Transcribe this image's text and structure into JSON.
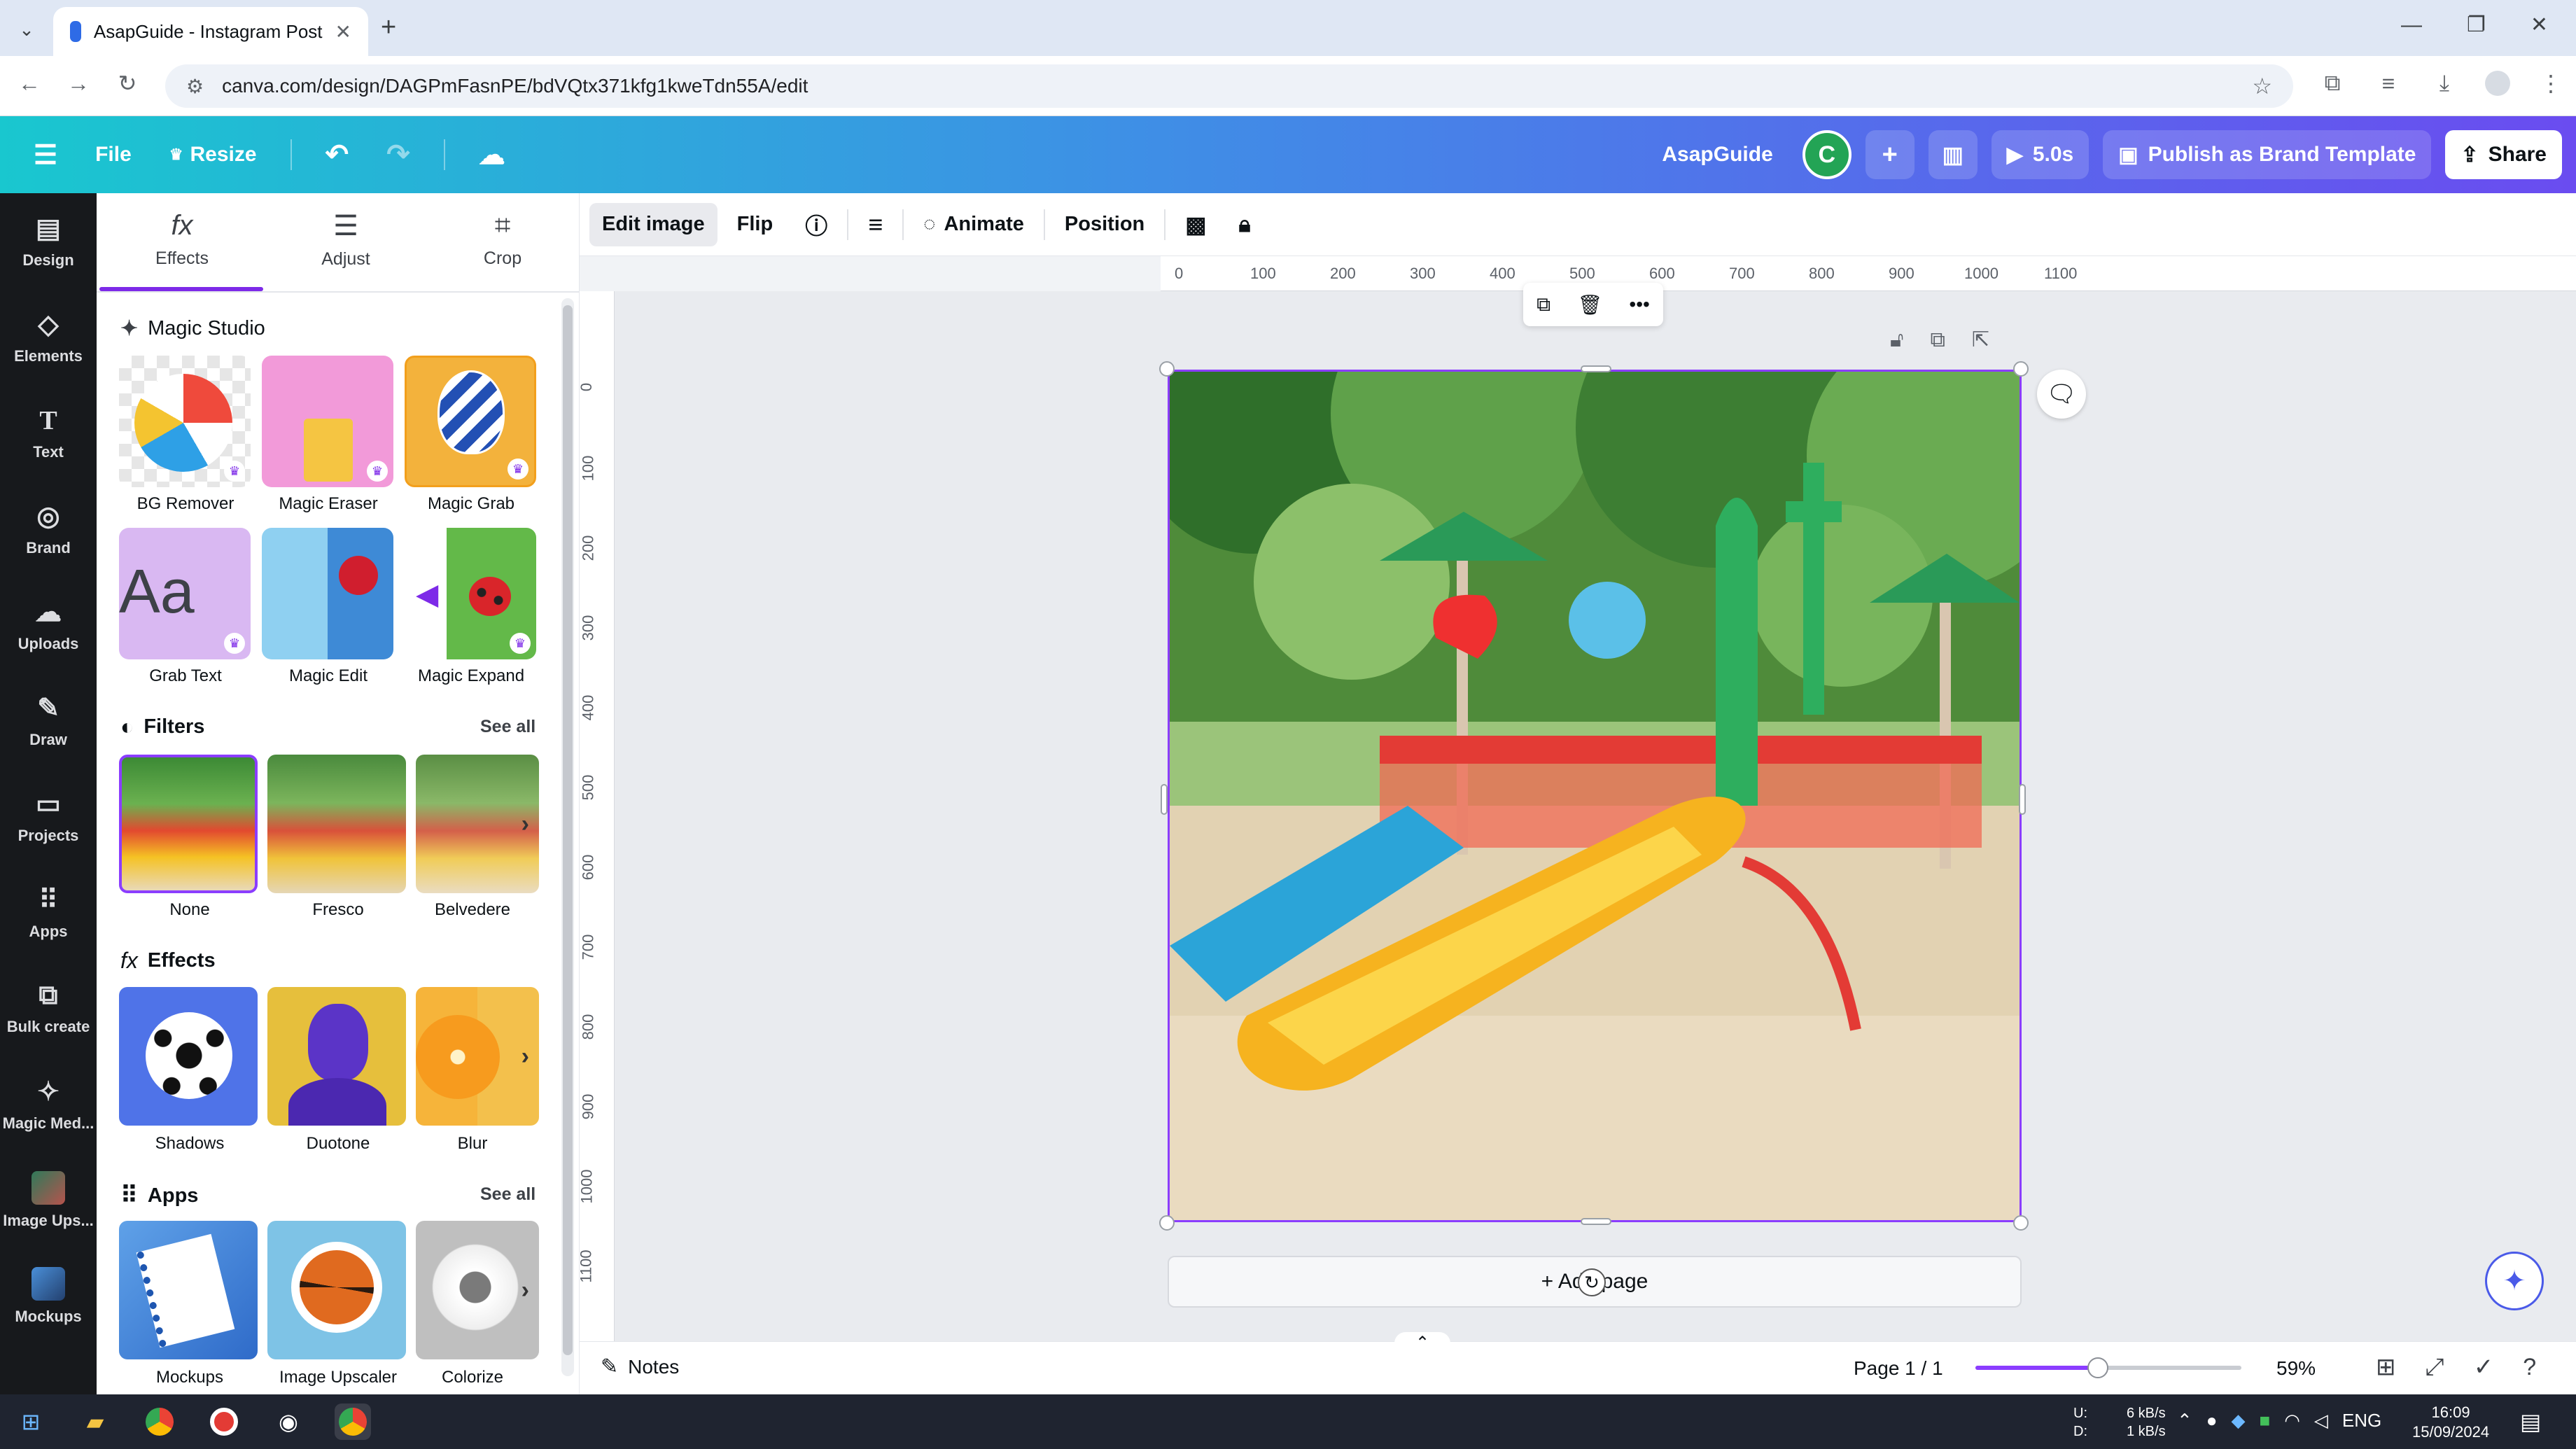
{
  "browser": {
    "tab_title": "AsapGuide - Instagram Post",
    "url": "canva.com/design/DAGPmFasnPE/bdVQtx371kfg1kweTdn55A/edit"
  },
  "header": {
    "file": "File",
    "resize": "Resize",
    "brand": "AsapGuide",
    "avatar_letter": "C",
    "play_time": "5.0s",
    "publish": "Publish as Brand Template",
    "share": "Share"
  },
  "rail": [
    {
      "label": "Design",
      "icon": "design-icon"
    },
    {
      "label": "Elements",
      "icon": "elements-icon"
    },
    {
      "label": "Text",
      "icon": "text-icon"
    },
    {
      "label": "Brand",
      "icon": "brand-icon"
    },
    {
      "label": "Uploads",
      "icon": "uploads-icon"
    },
    {
      "label": "Draw",
      "icon": "draw-icon"
    },
    {
      "label": "Projects",
      "icon": "projects-icon"
    },
    {
      "label": "Apps",
      "icon": "apps-icon"
    },
    {
      "label": "Bulk create",
      "icon": "bulk-create-icon"
    },
    {
      "label": "Magic Med...",
      "icon": "magic-media-icon"
    },
    {
      "label": "Image Ups...",
      "icon": "image-upscaler-icon"
    },
    {
      "label": "Mockups",
      "icon": "mockups-icon"
    }
  ],
  "panel": {
    "tabs": [
      {
        "label": "Effects"
      },
      {
        "label": "Adjust"
      },
      {
        "label": "Crop"
      }
    ],
    "magic_studio": {
      "title": "Magic Studio",
      "tools": [
        {
          "label": "BG Remover"
        },
        {
          "label": "Magic Eraser"
        },
        {
          "label": "Magic Grab"
        },
        {
          "label": "Grab Text"
        },
        {
          "label": "Magic Edit"
        },
        {
          "label": "Magic Expand"
        }
      ]
    },
    "filters": {
      "title": "Filters",
      "see_all": "See all",
      "items": [
        {
          "label": "None"
        },
        {
          "label": "Fresco"
        },
        {
          "label": "Belvedere"
        }
      ]
    },
    "effects": {
      "title": "Effects",
      "items": [
        {
          "label": "Shadows"
        },
        {
          "label": "Duotone"
        },
        {
          "label": "Blur"
        }
      ]
    },
    "apps": {
      "title": "Apps",
      "see_all": "See all",
      "items": [
        {
          "label": "Mockups"
        },
        {
          "label": "Image Upscaler"
        },
        {
          "label": "Colorize"
        }
      ]
    }
  },
  "toolbar": {
    "edit_image": "Edit image",
    "flip": "Flip",
    "animate": "Animate",
    "position": "Position"
  },
  "ruler": {
    "h": [
      "0",
      "100",
      "200",
      "300",
      "400",
      "500",
      "600",
      "700",
      "800",
      "900",
      "1000",
      "1100"
    ],
    "v": [
      "0",
      "100",
      "200",
      "300",
      "400",
      "500",
      "600",
      "700",
      "800",
      "900",
      "1000",
      "1100"
    ]
  },
  "canvas": {
    "add_page": "+ Add page"
  },
  "footer": {
    "notes": "Notes",
    "page": "Page 1 / 1",
    "zoom": "59%",
    "zoom_level": 0.46
  },
  "taskbar": {
    "net_up_label": "U:",
    "net_down_label": "D:",
    "net_up": "6 kB/s",
    "net_down": "1 kB/s",
    "lang": "ENG",
    "time": "16:09",
    "date": "15/09/2024"
  }
}
